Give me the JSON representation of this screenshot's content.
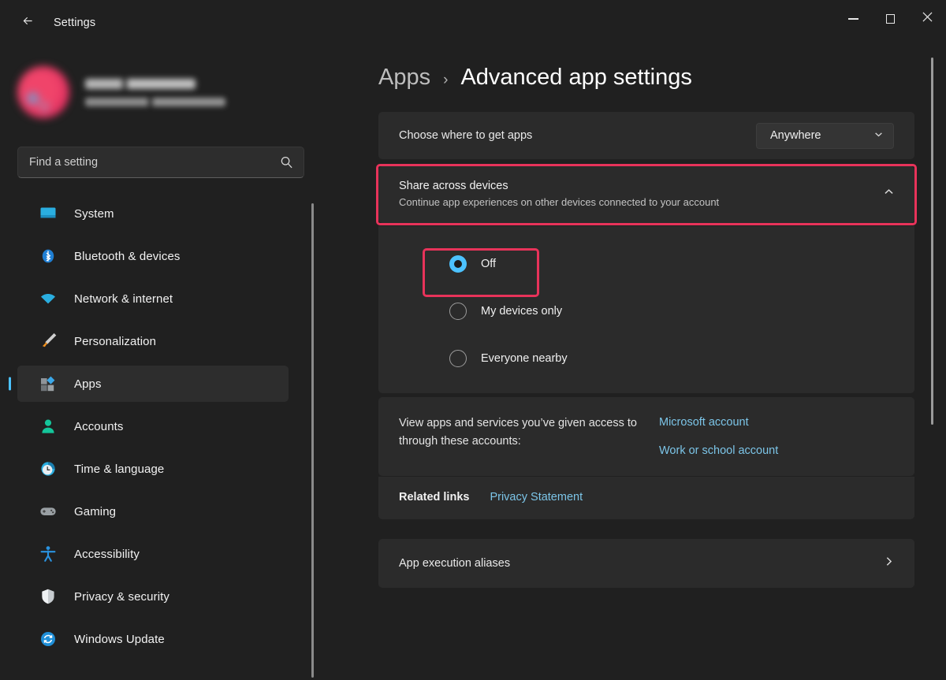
{
  "window": {
    "app_title": "Settings",
    "back_icon": "arrow-left-icon",
    "controls": {
      "minimize": "minimize-icon",
      "maximize": "maximize-icon",
      "close": "close-icon"
    }
  },
  "sidebar": {
    "account": {
      "name_redacted": "",
      "email_redacted": ""
    },
    "search": {
      "placeholder": "Find a setting",
      "value": "",
      "icon": "search-icon"
    },
    "items": [
      {
        "label": "System",
        "icon": "monitor-icon",
        "selected": false
      },
      {
        "label": "Bluetooth & devices",
        "icon": "bluetooth-icon",
        "selected": false
      },
      {
        "label": "Network & internet",
        "icon": "wifi-icon",
        "selected": false
      },
      {
        "label": "Personalization",
        "icon": "paintbrush-icon",
        "selected": false
      },
      {
        "label": "Apps",
        "icon": "apps-grid-icon",
        "selected": true
      },
      {
        "label": "Accounts",
        "icon": "person-icon",
        "selected": false
      },
      {
        "label": "Time & language",
        "icon": "clock-icon",
        "selected": false
      },
      {
        "label": "Gaming",
        "icon": "gamepad-icon",
        "selected": false
      },
      {
        "label": "Accessibility",
        "icon": "accessibility-person-icon",
        "selected": false
      },
      {
        "label": "Privacy & security",
        "icon": "shield-icon",
        "selected": false
      },
      {
        "label": "Windows Update",
        "icon": "refresh-circle-icon",
        "selected": false
      }
    ]
  },
  "main": {
    "breadcrumb": {
      "parent": "Apps",
      "separator": "›",
      "current": "Advanced app settings"
    },
    "get_apps": {
      "label": "Choose where to get apps",
      "selected_value": "Anywhere",
      "chevron": "chevron-down-icon"
    },
    "share_across_devices": {
      "title": "Share across devices",
      "subtitle": "Continue app experiences on other devices connected to your account",
      "expanded": true,
      "chevron": "chevron-up-icon",
      "highlighted": true,
      "options": [
        {
          "label": "Off",
          "checked": true,
          "highlighted": true
        },
        {
          "label": "My devices only",
          "checked": false,
          "highlighted": false
        },
        {
          "label": "Everyone nearby",
          "checked": false,
          "highlighted": false
        }
      ]
    },
    "accounts_access": {
      "text": "View apps and services you’ve given access to through these accounts:",
      "links": [
        "Microsoft account",
        "Work or school account"
      ]
    },
    "related": {
      "title": "Related links",
      "links": [
        "Privacy Statement"
      ]
    },
    "app_execution_aliases": {
      "label": "App execution aliases",
      "chevron": "chevron-right-icon"
    }
  },
  "colors": {
    "accent_blue": "#4cc2ff",
    "link_blue": "#7cc5e8",
    "highlight_red": "#e8335a",
    "window_bg": "#202020",
    "card_bg": "#2b2b2b"
  }
}
